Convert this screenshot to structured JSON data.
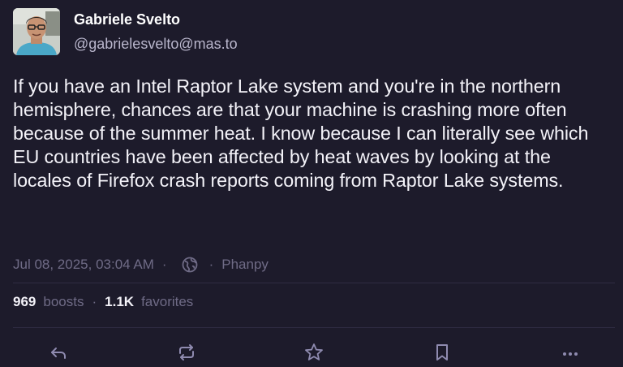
{
  "author": {
    "display_name": "Gabriele Svelto",
    "handle": "@gabrielesvelto@mas.to",
    "avatar_icon": "avatar-photo"
  },
  "post": {
    "text": "If you have an Intel Raptor Lake system and you're in the northern hemisphere, chances are that your machine is crashing more often because of the summer heat. I know because I can literally see which EU countries have been affected by heat waves by looking at the locales of Firefox crash reports coming from Raptor Lake systems."
  },
  "meta": {
    "timestamp": "Jul 08, 2025, 03:04 AM",
    "separator": "·",
    "visibility_icon": "globe-icon",
    "client": "Phanpy"
  },
  "stats": {
    "boosts_count": "969",
    "boosts_label": "boosts",
    "separator": "·",
    "favorites_count": "1.1K",
    "favorites_label": "favorites"
  },
  "actions": {
    "icons": [
      "reply-icon",
      "boost-icon",
      "star-icon",
      "bookmark-icon",
      "more-icon"
    ]
  },
  "colors": {
    "background": "#1d1b2b",
    "text": "#f3f2f8",
    "muted": "#6f6b86",
    "handle": "#b9b6cc",
    "icon": "#8f8bb0"
  }
}
